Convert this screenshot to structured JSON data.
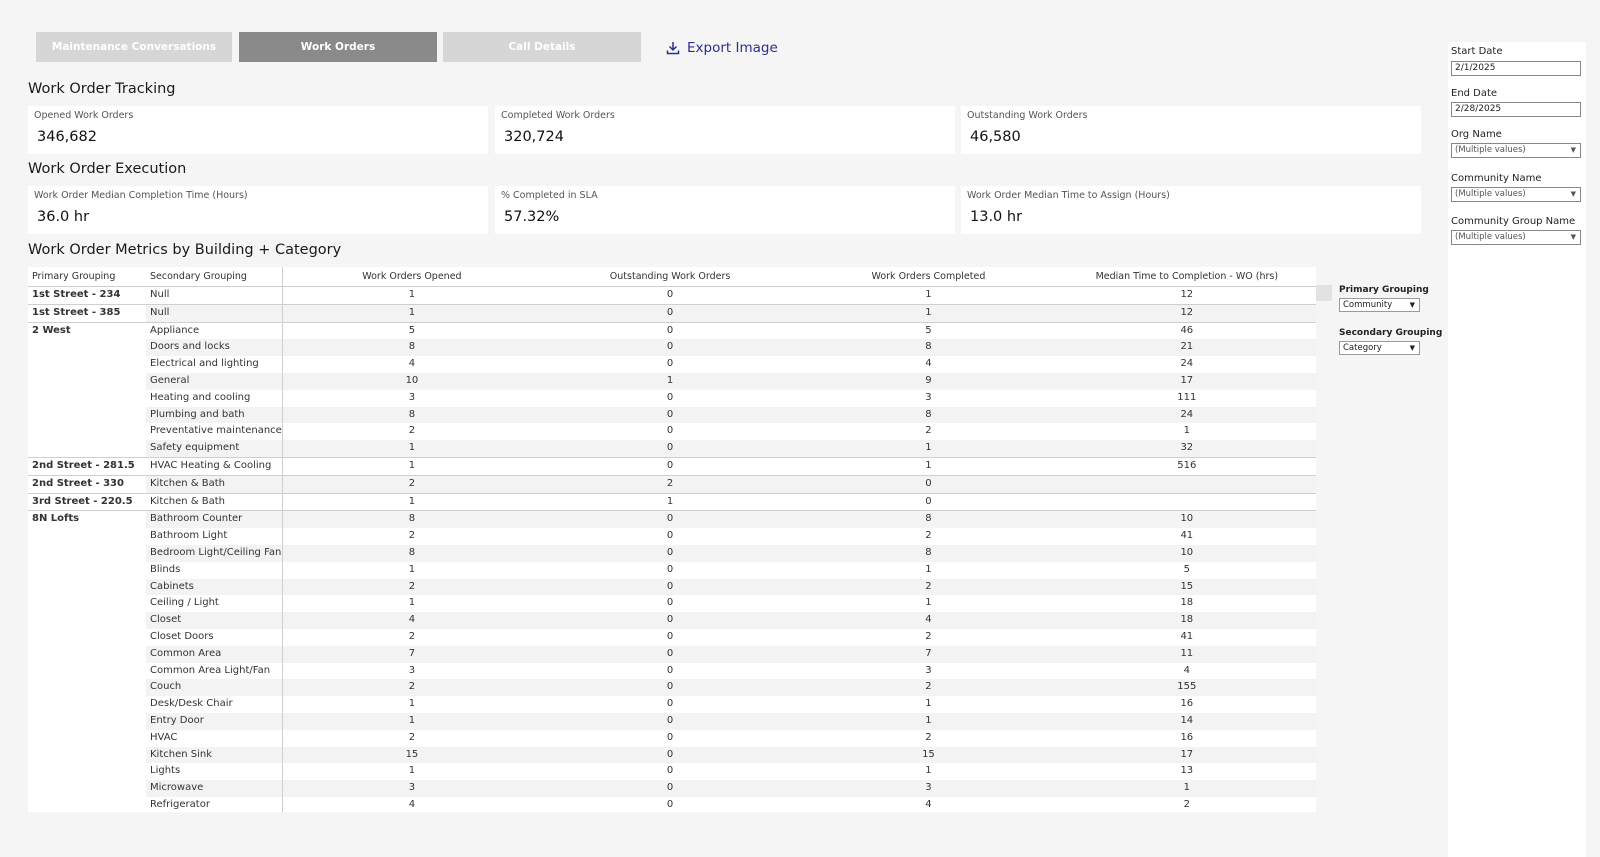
{
  "tabs": {
    "maintenance": "Maintenance Conversations",
    "work_orders": "Work Orders",
    "call_details": "Call Details"
  },
  "export_label": "Export Image",
  "sections": {
    "tracking": "Work Order Tracking",
    "execution": "Work Order Execution",
    "metrics": "Work Order Metrics by Building + Category"
  },
  "kpis": {
    "opened": {
      "label": "Opened Work Orders",
      "value": "346,682"
    },
    "completed": {
      "label": "Completed Work Orders",
      "value": "320,724"
    },
    "outstanding": {
      "label": "Outstanding Work Orders",
      "value": "46,580"
    },
    "median_completion": {
      "label": "Work Order Median Completion Time (Hours)",
      "value": "36.0 hr"
    },
    "sla": {
      "label": "% Completed in SLA",
      "value": "57.32%"
    },
    "median_assign": {
      "label": "Work Order Median Time to Assign (Hours)",
      "value": "13.0 hr"
    }
  },
  "table": {
    "headers": [
      "Primary Grouping",
      "Secondary Grouping",
      "Work Orders Opened",
      "Outstanding Work Orders",
      "Work Orders Completed",
      "Median Time to Completion - WO (hrs)"
    ],
    "rows": [
      {
        "primary": "1st Street - 234",
        "secondary": "Null",
        "opened": "1",
        "outstanding": "0",
        "completed": "1",
        "median": "12"
      },
      {
        "primary": "1st Street - 385",
        "secondary": "Null",
        "opened": "1",
        "outstanding": "0",
        "completed": "1",
        "median": "12"
      },
      {
        "primary": "2 West",
        "secondary": "Appliance",
        "opened": "5",
        "outstanding": "0",
        "completed": "5",
        "median": "46"
      },
      {
        "primary": "",
        "secondary": "Doors and locks",
        "opened": "8",
        "outstanding": "0",
        "completed": "8",
        "median": "21"
      },
      {
        "primary": "",
        "secondary": "Electrical and lighting",
        "opened": "4",
        "outstanding": "0",
        "completed": "4",
        "median": "24"
      },
      {
        "primary": "",
        "secondary": "General",
        "opened": "10",
        "outstanding": "1",
        "completed": "9",
        "median": "17"
      },
      {
        "primary": "",
        "secondary": "Heating and cooling",
        "opened": "3",
        "outstanding": "0",
        "completed": "3",
        "median": "111"
      },
      {
        "primary": "",
        "secondary": "Plumbing and bath",
        "opened": "8",
        "outstanding": "0",
        "completed": "8",
        "median": "24"
      },
      {
        "primary": "",
        "secondary": "Preventative maintenance",
        "opened": "2",
        "outstanding": "0",
        "completed": "2",
        "median": "1"
      },
      {
        "primary": "",
        "secondary": "Safety equipment",
        "opened": "1",
        "outstanding": "0",
        "completed": "1",
        "median": "32"
      },
      {
        "primary": "2nd Street - 281.5",
        "secondary": "HVAC Heating & Cooling",
        "opened": "1",
        "outstanding": "0",
        "completed": "1",
        "median": "516"
      },
      {
        "primary": "2nd Street - 330",
        "secondary": "Kitchen & Bath",
        "opened": "2",
        "outstanding": "2",
        "completed": "0",
        "median": ""
      },
      {
        "primary": "3rd Street - 220.5",
        "secondary": "Kitchen & Bath",
        "opened": "1",
        "outstanding": "1",
        "completed": "0",
        "median": ""
      },
      {
        "primary": "8N Lofts",
        "secondary": "Bathroom Counter",
        "opened": "8",
        "outstanding": "0",
        "completed": "8",
        "median": "10"
      },
      {
        "primary": "",
        "secondary": "Bathroom Light",
        "opened": "2",
        "outstanding": "0",
        "completed": "2",
        "median": "41"
      },
      {
        "primary": "",
        "secondary": "Bedroom Light/Ceiling Fan",
        "opened": "8",
        "outstanding": "0",
        "completed": "8",
        "median": "10"
      },
      {
        "primary": "",
        "secondary": "Blinds",
        "opened": "1",
        "outstanding": "0",
        "completed": "1",
        "median": "5"
      },
      {
        "primary": "",
        "secondary": "Cabinets",
        "opened": "2",
        "outstanding": "0",
        "completed": "2",
        "median": "15"
      },
      {
        "primary": "",
        "secondary": "Ceiling / Light",
        "opened": "1",
        "outstanding": "0",
        "completed": "1",
        "median": "18"
      },
      {
        "primary": "",
        "secondary": "Closet",
        "opened": "4",
        "outstanding": "0",
        "completed": "4",
        "median": "18"
      },
      {
        "primary": "",
        "secondary": "Closet Doors",
        "opened": "2",
        "outstanding": "0",
        "completed": "2",
        "median": "41"
      },
      {
        "primary": "",
        "secondary": "Common Area",
        "opened": "7",
        "outstanding": "0",
        "completed": "7",
        "median": "11"
      },
      {
        "primary": "",
        "secondary": "Common Area Light/Fan",
        "opened": "3",
        "outstanding": "0",
        "completed": "3",
        "median": "4"
      },
      {
        "primary": "",
        "secondary": "Couch",
        "opened": "2",
        "outstanding": "0",
        "completed": "2",
        "median": "155"
      },
      {
        "primary": "",
        "secondary": "Desk/Desk Chair",
        "opened": "1",
        "outstanding": "0",
        "completed": "1",
        "median": "16"
      },
      {
        "primary": "",
        "secondary": "Entry Door",
        "opened": "1",
        "outstanding": "0",
        "completed": "1",
        "median": "14"
      },
      {
        "primary": "",
        "secondary": "HVAC",
        "opened": "2",
        "outstanding": "0",
        "completed": "2",
        "median": "16"
      },
      {
        "primary": "",
        "secondary": "Kitchen Sink",
        "opened": "15",
        "outstanding": "0",
        "completed": "15",
        "median": "17"
      },
      {
        "primary": "",
        "secondary": "Lights",
        "opened": "1",
        "outstanding": "0",
        "completed": "1",
        "median": "13"
      },
      {
        "primary": "",
        "secondary": "Microwave",
        "opened": "3",
        "outstanding": "0",
        "completed": "3",
        "median": "1"
      },
      {
        "primary": "",
        "secondary": "Refrigerator",
        "opened": "4",
        "outstanding": "0",
        "completed": "4",
        "median": "2"
      }
    ]
  },
  "grouping": {
    "primary_label": "Primary Grouping",
    "primary_value": "Community",
    "secondary_label": "Secondary Grouping",
    "secondary_value": "Category"
  },
  "filters": {
    "start_date_label": "Start Date",
    "start_date_value": "2/1/2025",
    "end_date_label": "End Date",
    "end_date_value": "2/28/2025",
    "org_label": "Org Name",
    "org_value": "(Multiple values)",
    "community_label": "Community Name",
    "community_value": "(Multiple values)",
    "group_label": "Community Group Name",
    "group_value": "(Multiple values)"
  },
  "colors": {
    "active_tab": "#8a8a8a",
    "inactive_tab": "#d6d6d6",
    "export_link": "#2b2f8f"
  }
}
